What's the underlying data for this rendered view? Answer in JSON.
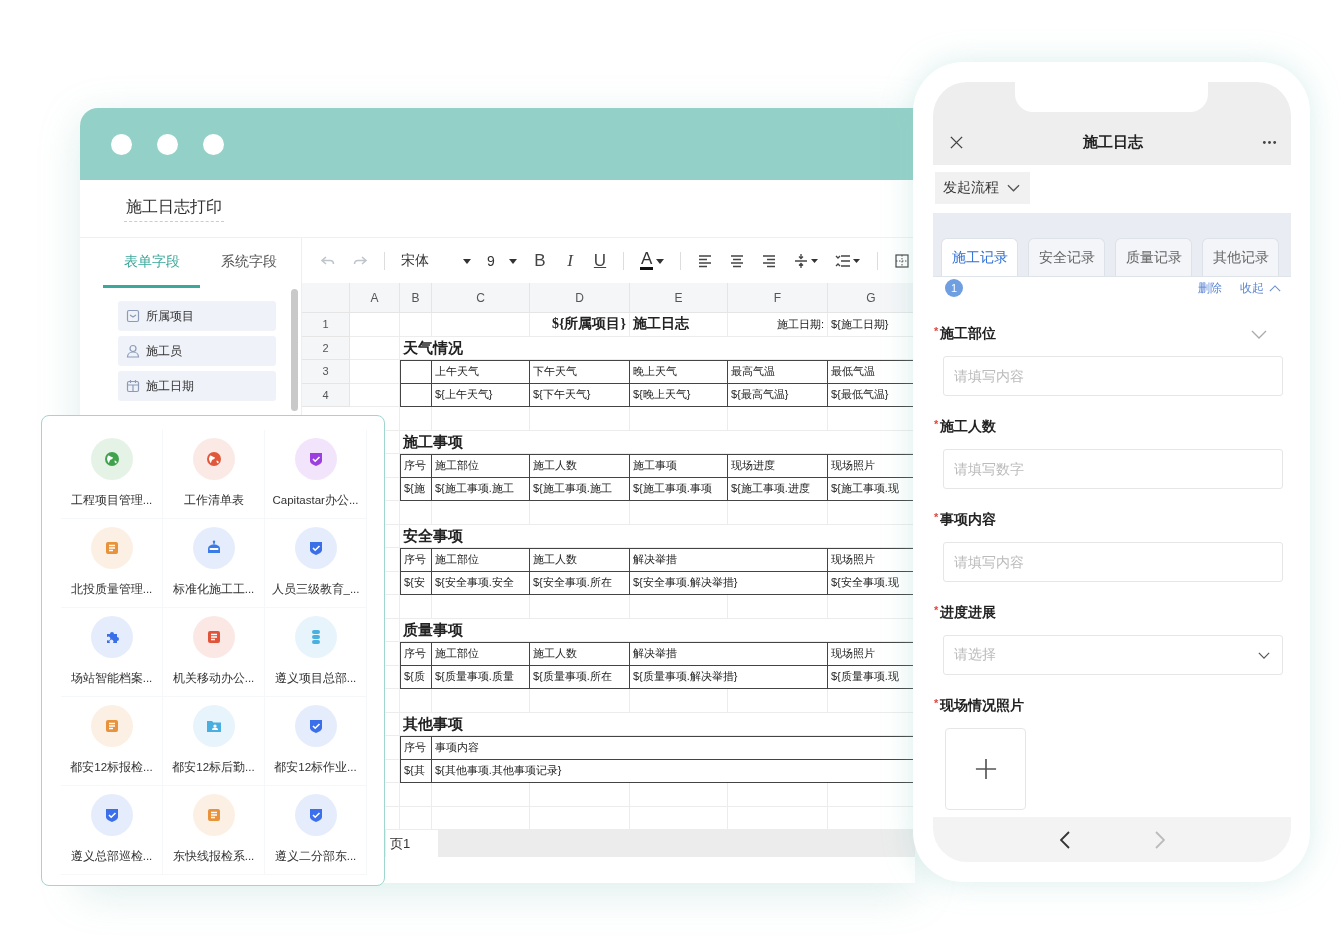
{
  "editor": {
    "window_title": "施工日志打印",
    "field_tabs": [
      {
        "label": "表单字段",
        "selected": true
      },
      {
        "label": "系统字段",
        "selected": false
      }
    ],
    "fields": [
      {
        "label": "所属项目"
      },
      {
        "label": "施工员"
      },
      {
        "label": "施工日期"
      }
    ],
    "toolbar": {
      "font": "宋体",
      "size": "9",
      "format_buttons": [
        "B",
        "I",
        "U"
      ],
      "font_color": "A"
    },
    "sheet": {
      "columns": [
        "A",
        "B",
        "C",
        "D",
        "E",
        "F",
        "G"
      ],
      "title_row": {
        "number": "1",
        "project": "${所属项目}",
        "title": "施工日志",
        "date_label": "施工日期:",
        "date": "${施工日期}"
      },
      "tables": [
        {
          "kind": "weather",
          "numbers": [
            "2",
            "3",
            "4"
          ],
          "title": "天气情况",
          "headers": [
            "上午天气",
            "下午天气",
            "晚上天气",
            "最高气温",
            "最低气温"
          ],
          "values": [
            "${上午天气}",
            "${下午天气}",
            "${晚上天气}",
            "${最高气温}",
            "${最低气温}"
          ]
        },
        {
          "kind": "items",
          "title": "施工事项",
          "headers": [
            "序号",
            "施工部位",
            "施工人数",
            "施工事项",
            "现场进度",
            "现场照片"
          ],
          "values": [
            "${施",
            "${施工事项.施工",
            "${施工事项.施工",
            "${施工事项.事项",
            "${施工事项.进度",
            "${施工事项.现"
          ]
        },
        {
          "kind": "measures",
          "title": "安全事项",
          "headers": [
            "序号",
            "施工部位",
            "施工人数",
            "解决举措",
            "现场照片"
          ],
          "values": [
            "${安",
            "${安全事项.安全",
            "${安全事项.所在",
            "${安全事项.解决举措}",
            "${安全事项.现"
          ]
        },
        {
          "kind": "measures",
          "title": "质量事项",
          "headers": [
            "序号",
            "施工部位",
            "施工人数",
            "解决举措",
            "现场照片"
          ],
          "values": [
            "${质",
            "${质量事项.质量",
            "${质量事项.所在",
            "${质量事项.解决举措}",
            "${质量事项.现"
          ]
        },
        {
          "kind": "notes",
          "title": "其他事项",
          "headers": [
            "序号",
            "事项内容"
          ],
          "values": [
            "${其",
            "${其他事项.其他事项记录}"
          ]
        }
      ],
      "sheet_tab": "页1"
    }
  },
  "app_grid": [
    {
      "label": "工程项目管理...",
      "color": "#3fa34d"
    },
    {
      "label": "工作清单表",
      "color": "#e0573a"
    },
    {
      "label": "Capitastar办公...",
      "color": "#9b3fe0"
    },
    {
      "label": "北投质量管理...",
      "color": "#e8923a"
    },
    {
      "label": "标准化施工工...",
      "color": "#3b7be8"
    },
    {
      "label": "人员三级教育_...",
      "color": "#3b6fe8"
    },
    {
      "label": "场站智能档案...",
      "color": "#3b6fe9"
    },
    {
      "label": "机关移动办公...",
      "color": "#e0553a"
    },
    {
      "label": "遵义项目总部...",
      "color": "#4ab0e0"
    },
    {
      "label": "都安12标报检...",
      "color": "#e8923b"
    },
    {
      "label": "都安12标后勤...",
      "color": "#4aaee0"
    },
    {
      "label": "都安12标作业...",
      "color": "#3b6fea"
    },
    {
      "label": "遵义总部巡检...",
      "color": "#3b6feb"
    },
    {
      "label": "东快线报检系...",
      "color": "#e8923c"
    },
    {
      "label": "遵义二分部东...",
      "color": "#3b6fec"
    }
  ],
  "mobile": {
    "title": "施工日志",
    "flow_button": "发起流程",
    "tabs": [
      {
        "label": "施工记录",
        "selected": true
      },
      {
        "label": "安全记录",
        "selected": false
      },
      {
        "label": "质量记录",
        "selected": false
      },
      {
        "label": "其他记录",
        "selected": false
      }
    ],
    "record_badge": "1",
    "delete_link": "删除",
    "collapse_link": "收起",
    "form_fields": [
      {
        "label": "施工部位",
        "required_mark": "*",
        "kind": "text",
        "placeholder": "请填写内容",
        "has_toggle": true
      },
      {
        "label": "施工人数",
        "required_mark": "*",
        "kind": "text",
        "placeholder": "请填写数字",
        "has_toggle": false
      },
      {
        "label": "事项内容",
        "required_mark": "*",
        "kind": "text",
        "placeholder": "请填写内容",
        "has_toggle": false
      },
      {
        "label": "进度进展",
        "required_mark": "*",
        "kind": "select",
        "placeholder": "请选择",
        "has_toggle": false
      },
      {
        "label": "现场情况照片",
        "required_mark": "*",
        "kind": "upload",
        "has_toggle": false
      }
    ],
    "nav_buttons": [
      {
        "kind": "back",
        "disabled": false
      },
      {
        "kind": "forward",
        "disabled": true
      }
    ]
  }
}
